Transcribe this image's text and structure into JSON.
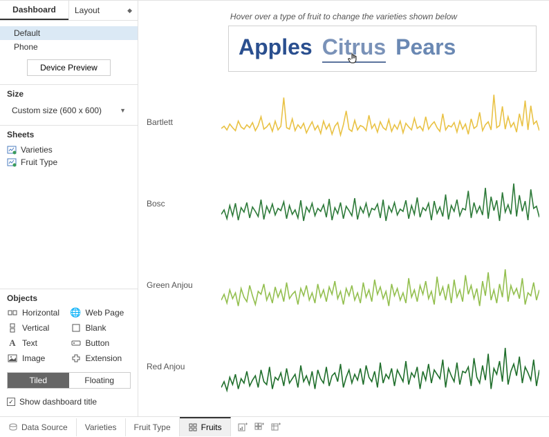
{
  "sidebar": {
    "tabs": {
      "dashboard": "Dashboard",
      "layout": "Layout"
    },
    "devices": {
      "default": "Default",
      "phone": "Phone"
    },
    "preview_btn": "Device Preview",
    "size": {
      "title": "Size",
      "value": "Custom size (600 x 600)"
    },
    "sheets": {
      "title": "Sheets",
      "items": [
        "Varieties",
        "Fruit Type"
      ]
    },
    "objects": {
      "title": "Objects",
      "items": {
        "horizontal": "Horizontal",
        "vertical": "Vertical",
        "text": "Text",
        "image": "Image",
        "webpage": "Web Page",
        "blank": "Blank",
        "button": "Button",
        "extension": "Extension"
      },
      "tiled": "Tiled",
      "floating": "Floating"
    },
    "show_title": "Show dashboard title"
  },
  "canvas": {
    "hint": "Hover over a type of fruit to change the varieties shown below",
    "fruits": {
      "apples": "Apples",
      "citrus": "Citrus",
      "pears": "Pears"
    }
  },
  "bottom": {
    "data_source": "Data Source",
    "tabs": [
      "Varieties",
      "Fruit Type",
      "Fruits"
    ]
  },
  "chart_data": [
    {
      "type": "line",
      "name": "Bartlett",
      "color": "#e9c245",
      "values": [
        42,
        45,
        40,
        48,
        43,
        39,
        52,
        44,
        41,
        47,
        43,
        50,
        39,
        46,
        58,
        41,
        44,
        49,
        38,
        52,
        40,
        45,
        84,
        43,
        41,
        55,
        39,
        47,
        42,
        49,
        36,
        44,
        51,
        40,
        46,
        35,
        52,
        41,
        48,
        34,
        45,
        50,
        33,
        47,
        66,
        41,
        38,
        53,
        40,
        46,
        44,
        39,
        60,
        42,
        48,
        37,
        51,
        43,
        40,
        54,
        38,
        47,
        41,
        52,
        36,
        49,
        44,
        40,
        56,
        42,
        45,
        39,
        58,
        41,
        47,
        51,
        43,
        38,
        62,
        40,
        46,
        44,
        50,
        37,
        52,
        41,
        48,
        34,
        55,
        42,
        45,
        64,
        39,
        47,
        51,
        40,
        88,
        43,
        46,
        72,
        41,
        58,
        44,
        50,
        37,
        62,
        45,
        80,
        40,
        73,
        48,
        52,
        39
      ]
    },
    {
      "type": "line",
      "name": "Bosc",
      "color": "#2d7a39",
      "values": [
        36,
        42,
        30,
        48,
        34,
        51,
        28,
        45,
        39,
        52,
        31,
        46,
        40,
        33,
        56,
        29,
        47,
        38,
        50,
        35,
        44,
        41,
        53,
        30,
        48,
        36,
        42,
        31,
        55,
        27,
        46,
        39,
        51,
        34,
        44,
        40,
        49,
        32,
        57,
        28,
        45,
        37,
        52,
        30,
        47,
        41,
        34,
        58,
        29,
        46,
        38,
        51,
        33,
        44,
        42,
        50,
        31,
        56,
        27,
        47,
        39,
        52,
        35,
        43,
        40,
        55,
        30,
        48,
        36,
        59,
        32,
        45,
        41,
        51,
        28,
        54,
        37,
        46,
        33,
        63,
        29,
        48,
        40,
        56,
        34,
        44,
        42,
        68,
        31,
        52,
        38,
        47,
        35,
        72,
        30,
        60,
        41,
        55,
        27,
        66,
        39,
        49,
        36,
        78,
        33,
        62,
        40,
        54,
        28,
        70,
        44,
        47,
        32
      ]
    },
    {
      "type": "line",
      "name": "Green Anjou",
      "color": "#93bf4f",
      "values": [
        30,
        38,
        26,
        44,
        32,
        40,
        22,
        46,
        34,
        28,
        50,
        36,
        24,
        42,
        38,
        52,
        30,
        40,
        26,
        48,
        34,
        44,
        28,
        54,
        32,
        38,
        42,
        24,
        46,
        36,
        50,
        30,
        40,
        26,
        52,
        34,
        44,
        28,
        48,
        38,
        56,
        32,
        42,
        24,
        46,
        36,
        50,
        30,
        40,
        26,
        54,
        34,
        44,
        28,
        58,
        38,
        48,
        32,
        42,
        22,
        52,
        36,
        46,
        30,
        40,
        26,
        60,
        34,
        44,
        28,
        50,
        38,
        56,
        32,
        42,
        24,
        62,
        36,
        48,
        30,
        52,
        26,
        58,
        34,
        44,
        28,
        64,
        38,
        50,
        32,
        46,
        22,
        56,
        36,
        68,
        30,
        44,
        26,
        52,
        34,
        72,
        28,
        50,
        38,
        46,
        32,
        60,
        24,
        40,
        36,
        54,
        30,
        44
      ]
    },
    {
      "type": "line",
      "name": "Red Anjou",
      "color": "#1f6e2b",
      "values": [
        22,
        30,
        18,
        36,
        26,
        40,
        20,
        34,
        28,
        44,
        24,
        32,
        38,
        22,
        46,
        30,
        26,
        50,
        20,
        36,
        32,
        42,
        24,
        48,
        28,
        34,
        40,
        22,
        52,
        30,
        38,
        26,
        44,
        20,
        46,
        34,
        28,
        50,
        24,
        38,
        42,
        30,
        54,
        22,
        36,
        46,
        28,
        40,
        32,
        48,
        26,
        52,
        36,
        30,
        44,
        22,
        56,
        28,
        40,
        34,
        48,
        24,
        46,
        38,
        30,
        58,
        26,
        42,
        36,
        50,
        20,
        44,
        32,
        54,
        28,
        46,
        40,
        34,
        60,
        22,
        48,
        38,
        30,
        56,
        26,
        44,
        42,
        50,
        24,
        62,
        36,
        28,
        52,
        32,
        68,
        20,
        48,
        40,
        58,
        30,
        76,
        26,
        44,
        54,
        38,
        64,
        28,
        50,
        42,
        32,
        60,
        24,
        46
      ]
    }
  ]
}
